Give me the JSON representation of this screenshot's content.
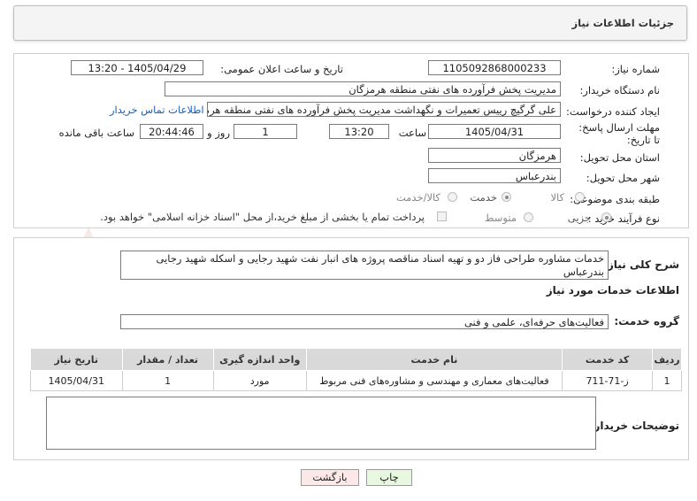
{
  "header": {
    "title": "جزئیات اطلاعات نیاز"
  },
  "form": {
    "need_number": {
      "label": "شماره نیاز:",
      "value": "1105092868000233"
    },
    "announce_datetime": {
      "label": "تاریخ و ساعت اعلان عمومی:",
      "value": "1405/04/29 - 13:20"
    },
    "buyer_org": {
      "label": "نام دستگاه خریدار:",
      "value": "مدیریت پخش فرآورده های نفتی منطقه هرمزگان"
    },
    "requester": {
      "label": "ایجاد کننده درخواست:",
      "value": "علی گرگیچ رییس تعمیرات و نگهداشت مدیریت پخش فرآورده های نفتی منطقه هرمزگان"
    },
    "buyer_contact_link": "اطلاعات تماس خریدار",
    "deadline": {
      "label": "مهلت ارسال پاسخ: تا تاریخ:",
      "date": "1405/04/31",
      "time_label": "ساعت",
      "time": "13:20",
      "days": "1",
      "days_label": "روز و",
      "remaining": "20:44:46",
      "remaining_label": "ساعت باقی مانده"
    },
    "province": {
      "label": "استان محل تحویل:",
      "value": "هرمزگان"
    },
    "city": {
      "label": "شهر محل تحویل:",
      "value": "بندرعباس"
    },
    "category": {
      "label": "طبقه بندی موضوعی:",
      "options": [
        "کالا",
        "خدمت",
        "کالا/خدمت"
      ],
      "selected": "خدمت"
    },
    "purchase_type": {
      "label": "نوع فرآیند خرید :",
      "options": [
        "جزیی",
        "متوسط"
      ],
      "selected": "جزیی",
      "treasury_note": "پرداخت تمام یا بخشی از مبلغ خرید،از محل \"اسناد خزانه اسلامی\" خواهد بود."
    }
  },
  "details": {
    "summary_label": "شرح کلی نیاز:",
    "summary": "خدمات مشاوره طراحی فاز دو و تهیه اسناد مناقصه پروژه های انبار نفت شهید رجایی و اسکله شهید رجایی بندرعباس",
    "services_heading": "اطلاعات خدمات مورد نیاز",
    "service_group_label": "گروه خدمت:",
    "service_group": "فعالیت‌های حرفه‌ای، علمی و فنی",
    "table": {
      "headers": [
        "ردیف",
        "کد خدمت",
        "نام خدمت",
        "واحد اندازه گیری",
        "تعداد / مقدار",
        "تاریخ نیاز"
      ],
      "rows": [
        [
          "1",
          "ز-71-711",
          "فعالیت‌های معماری و مهندسی و مشاوره‌های فنی مربوط",
          "مورد",
          "1",
          "1405/04/31"
        ]
      ]
    },
    "buyer_notes_label": "توضیحات خریدار:",
    "buyer_notes": ""
  },
  "actions": {
    "print": "چاپ",
    "back": "بازگشت"
  },
  "watermark_text": "AriaTender.net",
  "colors": {
    "link": "#1a5fb4",
    "header_bg": "#f4f4f4",
    "table_header_bg": "#d9d9d9",
    "back_button_bg": "#fde8e8",
    "print_button_bg": "#e8f8e0"
  }
}
